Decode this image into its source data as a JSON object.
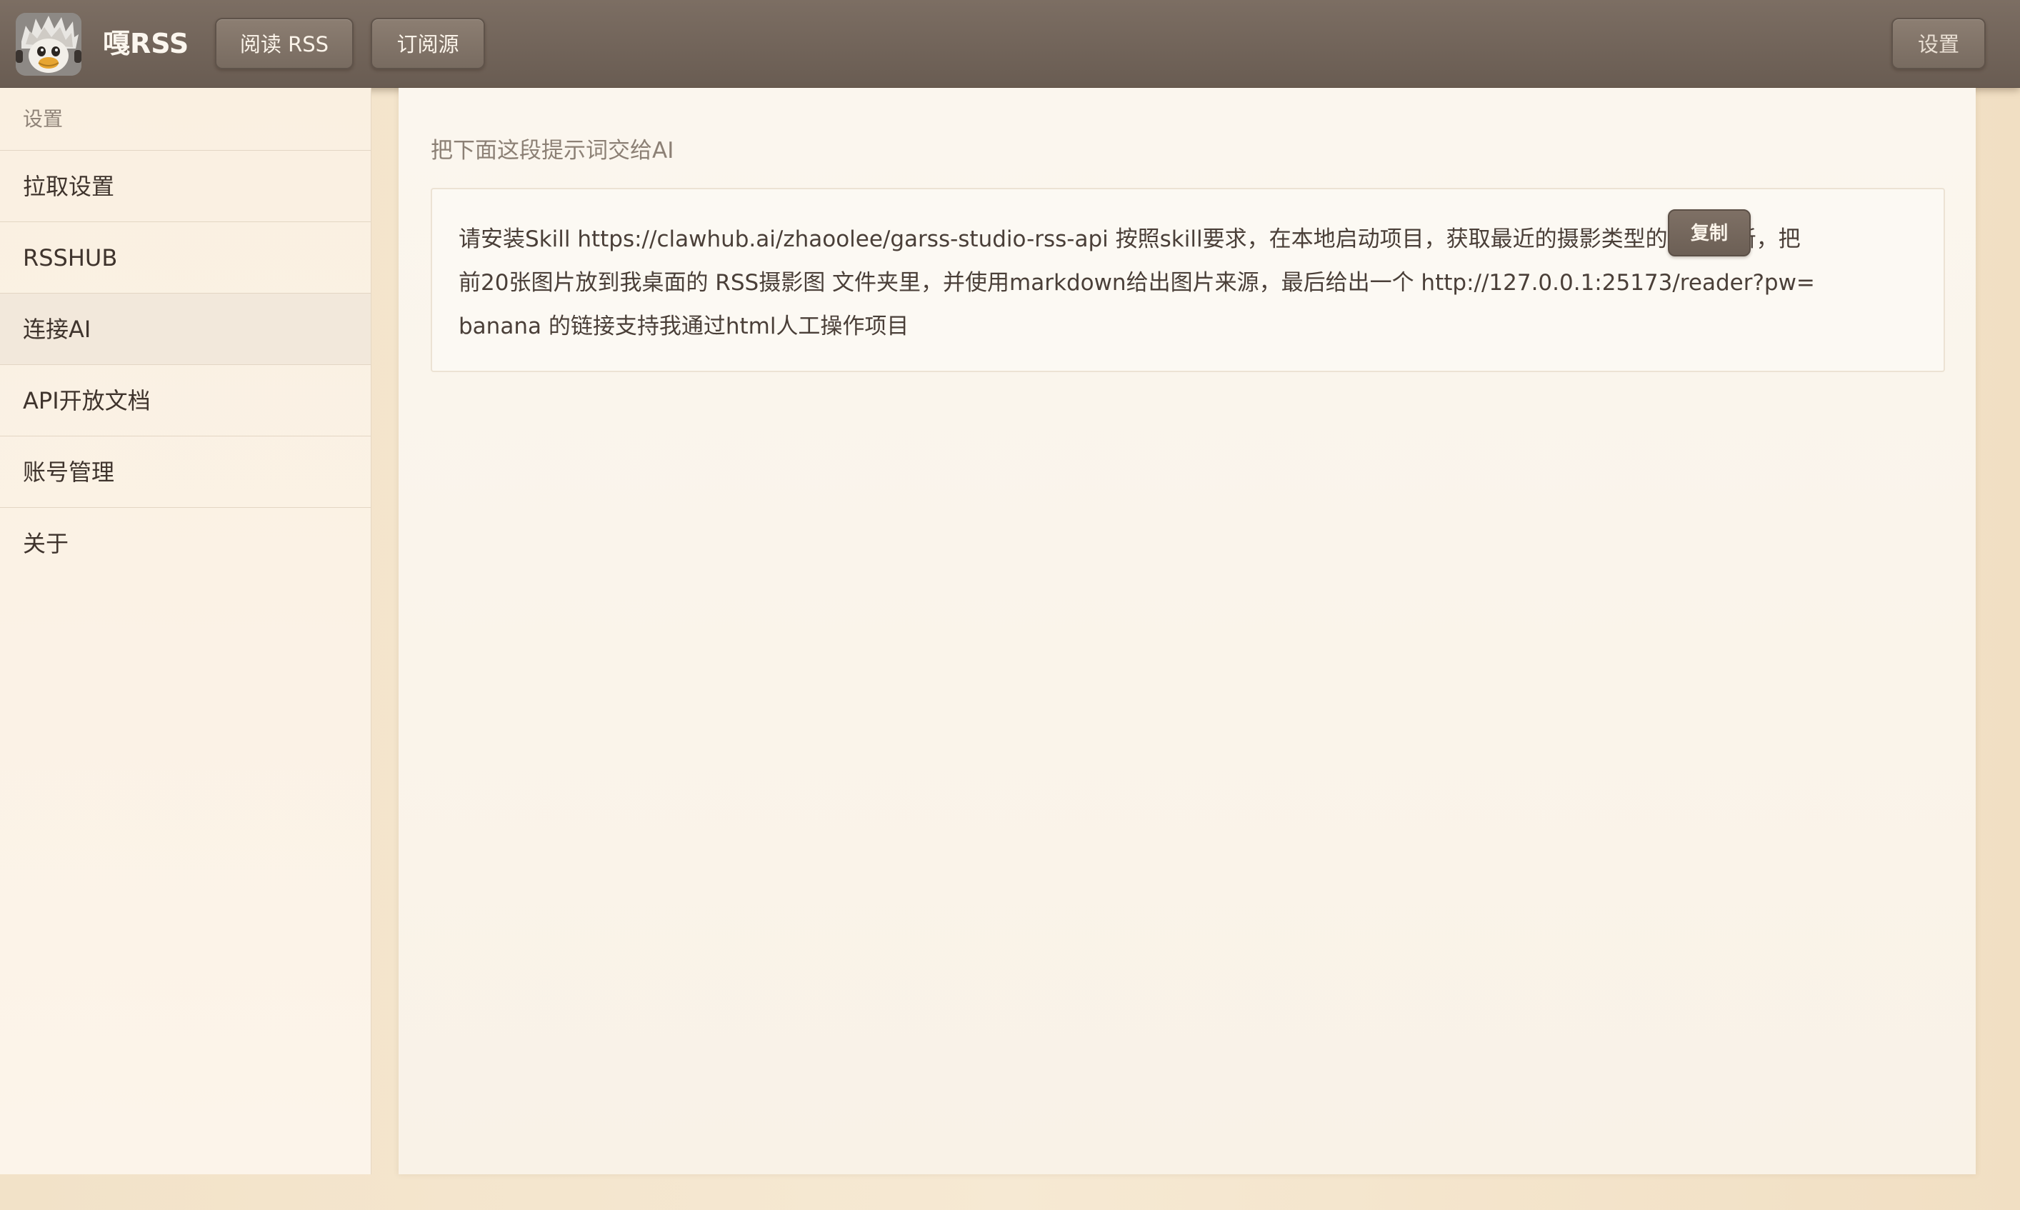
{
  "header": {
    "logo_icon": "penguin-avatar-icon",
    "brand": "嘎RSS",
    "nav_read": "阅读 RSS",
    "nav_subscribe": "订阅源",
    "nav_settings": "设置"
  },
  "sidebar": {
    "header": "设置",
    "items": [
      {
        "label": "拉取设置"
      },
      {
        "label": "RSSHUB"
      },
      {
        "label": "连接AI",
        "active": true
      },
      {
        "label": "API开放文档"
      },
      {
        "label": "账号管理"
      },
      {
        "label": "关于"
      }
    ]
  },
  "main": {
    "prompt_label": "把下面这段提示词交给AI",
    "prompt_text": "请安装Skill https://clawhub.ai/zhaoolee/garss-studio-rss-api 按照skill要求，在本地启动项目，获取最近的摄影类型的信息更新，把前20张图片放到我桌面的 RSS摄影图 文件夹里，并使用markdown给出图片来源，最后给出一个 http://127.0.0.1:25173/reader?pw=banana 的链接支持我通过html人工操作项目",
    "copy_label": "复制"
  },
  "colors": {
    "topbar": "#6f6258",
    "accent_button": "#74675c",
    "sidebar_bg": "#fbf2e6",
    "main_bg": "#fbf6ee",
    "page_bg": "#f2e2c8"
  }
}
